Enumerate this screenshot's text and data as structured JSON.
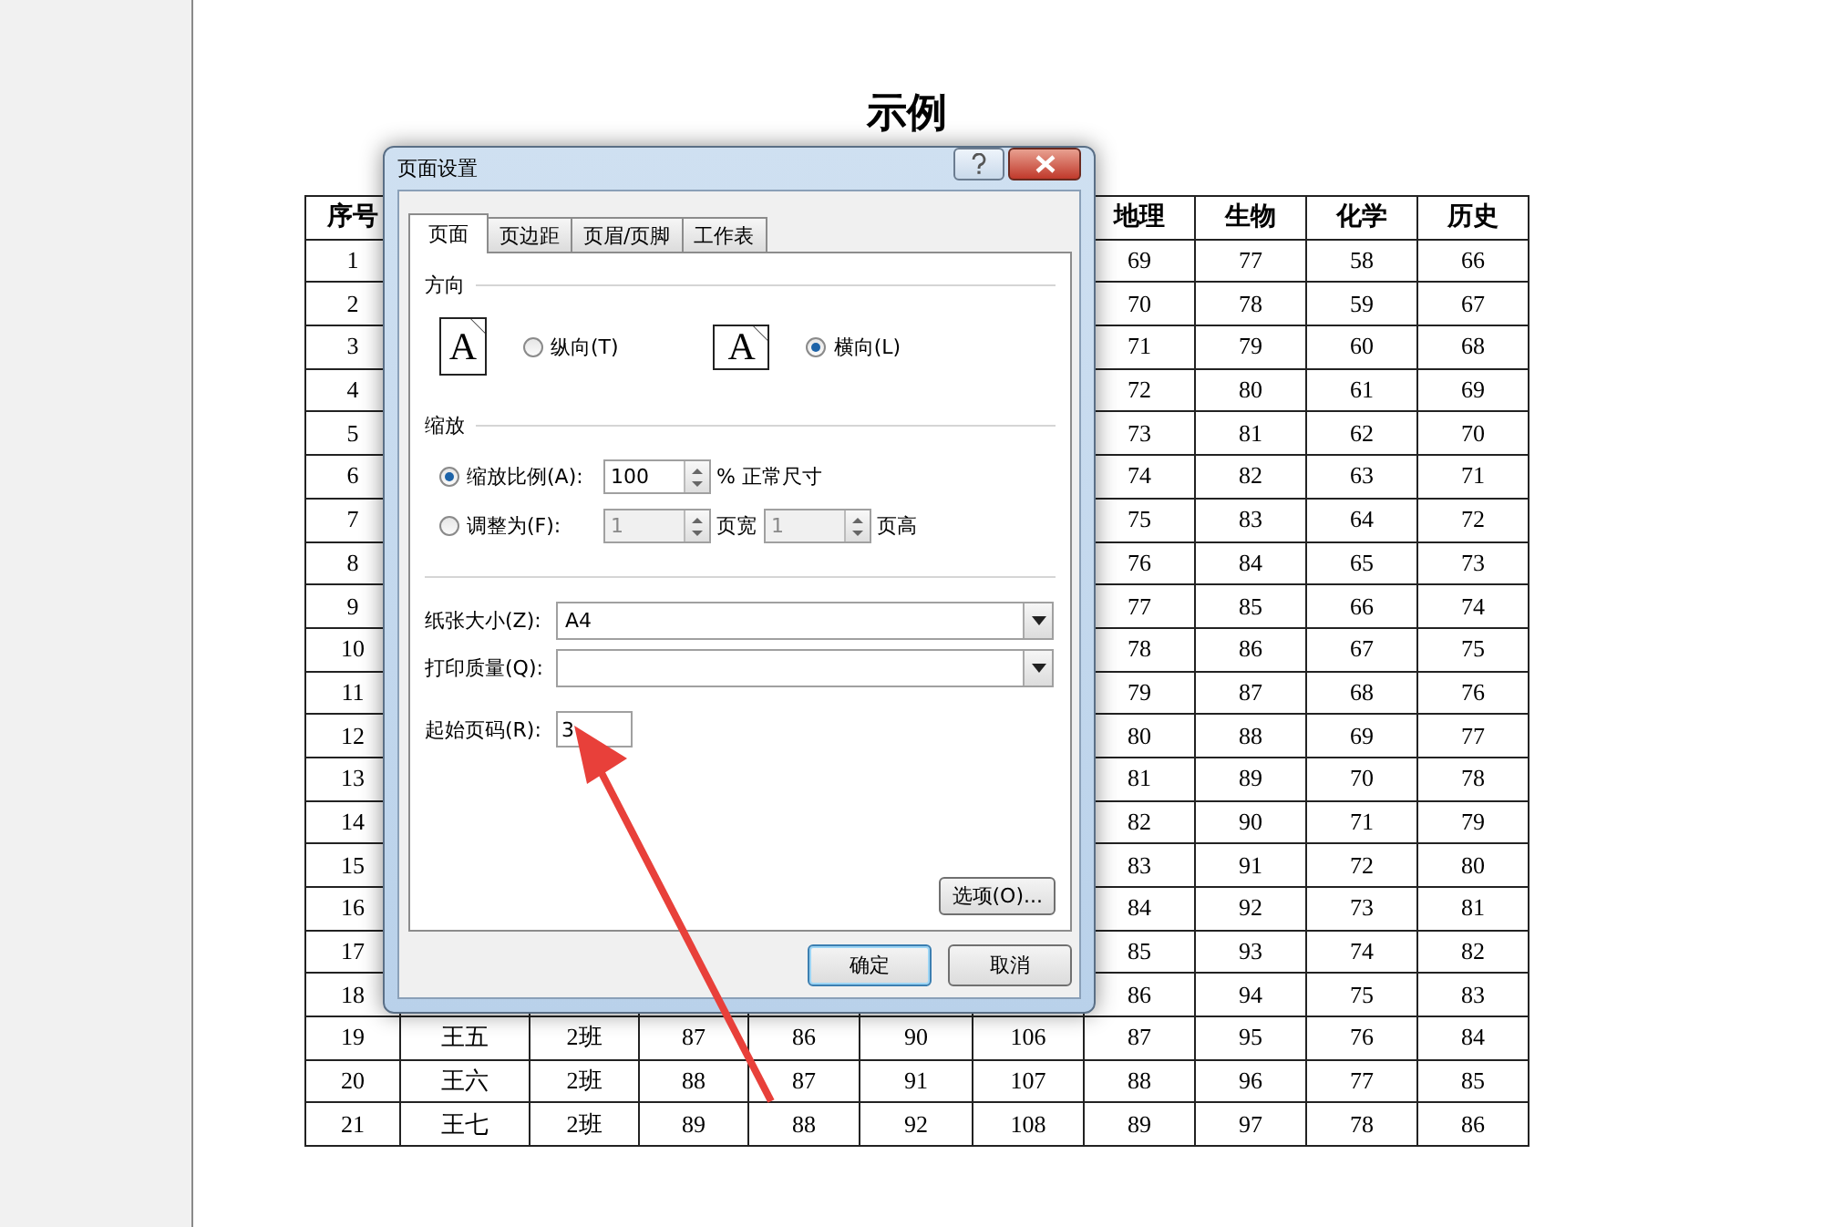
{
  "page": {
    "title": "示例"
  },
  "table": {
    "columns": [
      "序号",
      null,
      null,
      null,
      null,
      null,
      null,
      "地理",
      "生物",
      "化学",
      "历史"
    ],
    "rows": [
      [
        "1",
        null,
        null,
        null,
        null,
        null,
        null,
        "69",
        "77",
        "58",
        "66"
      ],
      [
        "2",
        null,
        null,
        null,
        null,
        null,
        null,
        "70",
        "78",
        "59",
        "67"
      ],
      [
        "3",
        null,
        null,
        null,
        null,
        null,
        null,
        "71",
        "79",
        "60",
        "68"
      ],
      [
        "4",
        null,
        null,
        null,
        null,
        null,
        null,
        "72",
        "80",
        "61",
        "69"
      ],
      [
        "5",
        null,
        null,
        null,
        null,
        null,
        null,
        "73",
        "81",
        "62",
        "70"
      ],
      [
        "6",
        null,
        null,
        null,
        null,
        null,
        null,
        "74",
        "82",
        "63",
        "71"
      ],
      [
        "7",
        null,
        null,
        null,
        null,
        null,
        null,
        "75",
        "83",
        "64",
        "72"
      ],
      [
        "8",
        null,
        null,
        null,
        null,
        null,
        null,
        "76",
        "84",
        "65",
        "73"
      ],
      [
        "9",
        null,
        null,
        null,
        null,
        null,
        null,
        "77",
        "85",
        "66",
        "74"
      ],
      [
        "10",
        null,
        null,
        null,
        null,
        null,
        null,
        "78",
        "86",
        "67",
        "75"
      ],
      [
        "11",
        null,
        null,
        null,
        null,
        null,
        null,
        "79",
        "87",
        "68",
        "76"
      ],
      [
        "12",
        null,
        null,
        null,
        null,
        null,
        null,
        "80",
        "88",
        "69",
        "77"
      ],
      [
        "13",
        null,
        null,
        null,
        null,
        null,
        null,
        "81",
        "89",
        "70",
        "78"
      ],
      [
        "14",
        null,
        null,
        null,
        null,
        null,
        null,
        "82",
        "90",
        "71",
        "79"
      ],
      [
        "15",
        null,
        null,
        null,
        null,
        null,
        null,
        "83",
        "91",
        "72",
        "80"
      ],
      [
        "16",
        null,
        null,
        null,
        null,
        null,
        null,
        "84",
        "92",
        "73",
        "81"
      ],
      [
        "17",
        null,
        null,
        null,
        null,
        null,
        null,
        "85",
        "93",
        "74",
        "82"
      ],
      [
        "18",
        null,
        null,
        null,
        null,
        null,
        null,
        "86",
        "94",
        "75",
        "83"
      ],
      [
        "19",
        "王五",
        "2班",
        "87",
        "86",
        "90",
        "106",
        "87",
        "95",
        "76",
        "84"
      ],
      [
        "20",
        "王六",
        "2班",
        "88",
        "87",
        "91",
        "107",
        "88",
        "96",
        "77",
        "85"
      ],
      [
        "21",
        "王七",
        "2班",
        "89",
        "88",
        "92",
        "108",
        "89",
        "97",
        "78",
        "86"
      ]
    ]
  },
  "dialog": {
    "title": "页面设置",
    "tabs": [
      {
        "label": "页面",
        "selected": true
      },
      {
        "label": "页边距",
        "selected": false
      },
      {
        "label": "页眉/页脚",
        "selected": false
      },
      {
        "label": "工作表",
        "selected": false
      }
    ],
    "orientation": {
      "heading": "方向",
      "options": [
        {
          "kind": "portrait",
          "icon_letter": "A",
          "label": "纵向(T)",
          "selected": false
        },
        {
          "kind": "landscape",
          "icon_letter": "A",
          "label": "横向(L)",
          "selected": true
        }
      ]
    },
    "scaling": {
      "heading": "缩放",
      "options": [
        {
          "label": "缩放比例(A):",
          "selected": true,
          "fields": [
            {
              "value": "100",
              "disabled": false,
              "unit": "% 正常尺寸"
            }
          ]
        },
        {
          "label": "调整为(F):",
          "selected": false,
          "fields": [
            {
              "value": "1",
              "disabled": true,
              "unit": "页宽"
            },
            {
              "value": "1",
              "disabled": true,
              "unit": "页高"
            }
          ]
        }
      ]
    },
    "selects": [
      {
        "label": "纸张大小(Z):",
        "value": "A4"
      },
      {
        "label": "打印质量(Q):"
      }
    ],
    "first_page": {
      "label": "起始页码(R):",
      "value": "3"
    },
    "options_button": "选项(O)...",
    "buttons": [
      {
        "label": "确定",
        "default": true
      },
      {
        "label": "取消",
        "default": false
      }
    ]
  }
}
